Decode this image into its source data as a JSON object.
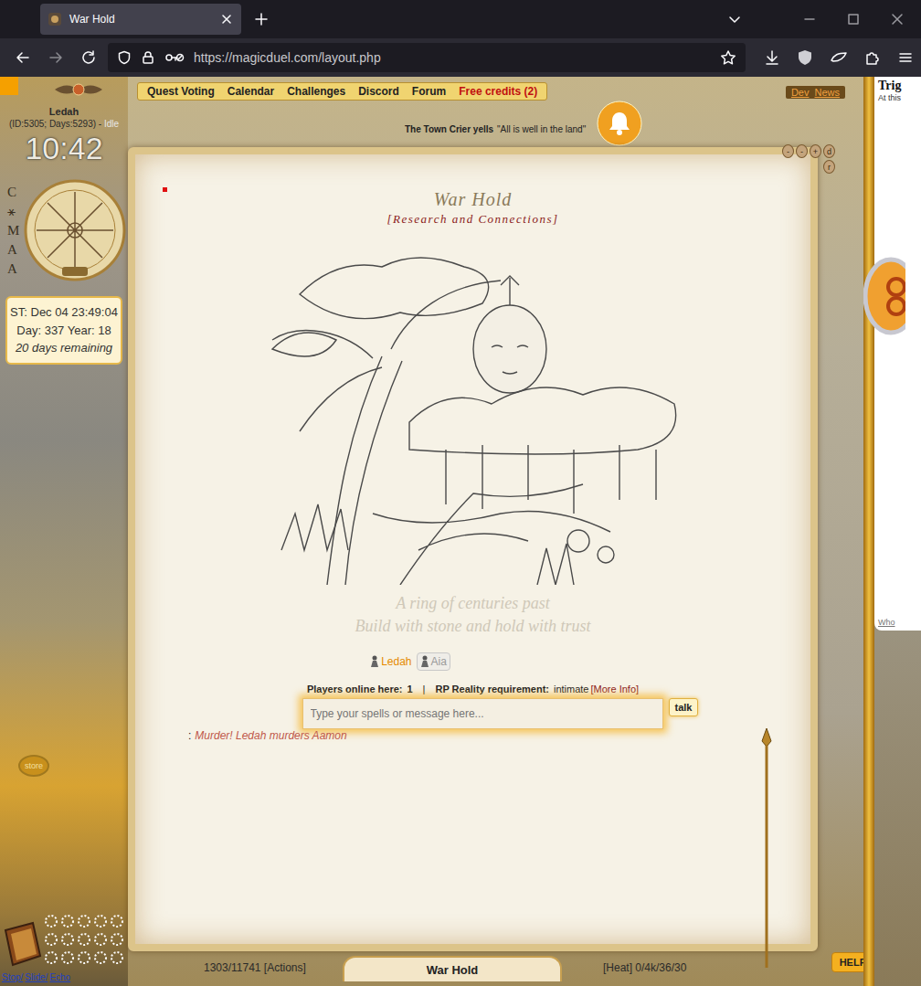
{
  "window": {
    "title": "War Hold"
  },
  "browser": {
    "tabs": [
      {
        "label": "War Hold",
        "selected": true
      }
    ],
    "url": "https://magicduel.com/layout.php"
  },
  "menu": [
    {
      "label": "Quest Voting",
      "highlight": false
    },
    {
      "label": "Calendar",
      "highlight": false
    },
    {
      "label": "Challenges",
      "highlight": false
    },
    {
      "label": "Discord",
      "highlight": false
    },
    {
      "label": "Forum",
      "highlight": false
    },
    {
      "label": "Free credits (2)",
      "highlight": true
    }
  ],
  "top_right_links": [
    "Dev",
    "News"
  ],
  "crier": {
    "speaker": "The Town Crier yells",
    "message": "\"All is well in the land\""
  },
  "player": {
    "name": "Ledah",
    "info": "(ID:5305; Days:5293) - ",
    "status": "Idle",
    "clock": "10:42"
  },
  "side_letters": [
    "C",
    "⚹",
    "M",
    "A",
    "A"
  ],
  "server_time": {
    "time": "ST: Dec 04 23:49:04",
    "day": "Day: 337 Year: 18",
    "remaining": "20 days remaining"
  },
  "zoom_buttons": [
    "-",
    "-",
    "+",
    "d",
    "r"
  ],
  "location": {
    "title": "War Hold",
    "subtitle": "[Research and Connections]",
    "verse": [
      "A ring of centuries past",
      "Build with stone and hold with trust"
    ]
  },
  "players_here": [
    {
      "name": "Ledah",
      "kind": "self",
      "color": "#e58a00"
    },
    {
      "name": "Aia",
      "kind": "other",
      "color": "#9a9a9a"
    }
  ],
  "online": {
    "label": "Players online here:",
    "count": "1",
    "separator": "|",
    "rp_label": "RP Reality requirement:",
    "rp_value": "intimate",
    "more": "[More Info]"
  },
  "chat": {
    "placeholder": "Type your spells or message here...",
    "button": "talk"
  },
  "messages": [
    {
      "prefix": ":",
      "text": "Murder! Ledah murders Aamon"
    }
  ],
  "store": "store",
  "status_bar": {
    "actions": "1303/11741 [Actions]",
    "location": "War Hold",
    "heat": "[Heat] 0/4k/36/30"
  },
  "help": "HELP",
  "footer_links": [
    "Stop/",
    "Slide/",
    "Echo"
  ],
  "right_panel": {
    "title": "Trig",
    "text": "At this",
    "footer": "Who"
  }
}
